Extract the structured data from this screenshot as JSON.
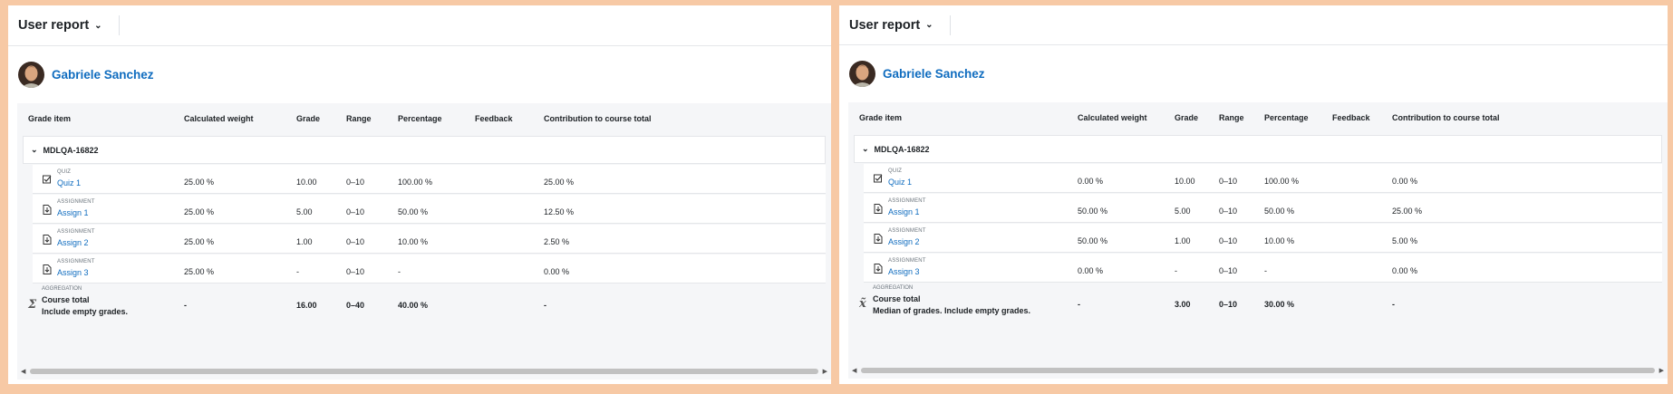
{
  "panels": [
    {
      "report_label": "User report",
      "user_name": "Gabriele Sanchez",
      "headers": [
        "Grade item",
        "Calculated weight",
        "Grade",
        "Range",
        "Percentage",
        "Feedback",
        "Contribution to course total"
      ],
      "category": "MDLQA-16822",
      "items": [
        {
          "type": "QUIZ",
          "name": "Quiz 1",
          "icon": "quiz-icon",
          "weight": "25.00 %",
          "grade": "10.00",
          "range": "0–10",
          "percentage": "100.00 %",
          "feedback": "",
          "contribution": "25.00 %"
        },
        {
          "type": "ASSIGNMENT",
          "name": "Assign 1",
          "icon": "assignment-icon",
          "weight": "25.00 %",
          "grade": "5.00",
          "range": "0–10",
          "percentage": "50.00 %",
          "feedback": "",
          "contribution": "12.50 %"
        },
        {
          "type": "ASSIGNMENT",
          "name": "Assign 2",
          "icon": "assignment-icon",
          "weight": "25.00 %",
          "grade": "1.00",
          "range": "0–10",
          "percentage": "10.00 %",
          "feedback": "",
          "contribution": "2.50 %"
        },
        {
          "type": "ASSIGNMENT",
          "name": "Assign 3",
          "icon": "assignment-icon",
          "weight": "25.00 %",
          "grade": "-",
          "range": "0–10",
          "percentage": "-",
          "feedback": "",
          "contribution": "0.00 %"
        }
      ],
      "total": {
        "type": "AGGREGATION",
        "name": "Course total",
        "desc": "Include empty grades.",
        "icon": "sum-icon",
        "weight": "-",
        "grade": "16.00",
        "range": "0–40",
        "percentage": "40.00 %",
        "contribution": "-"
      }
    },
    {
      "report_label": "User report",
      "user_name": "Gabriele Sanchez",
      "headers": [
        "Grade item",
        "Calculated weight",
        "Grade",
        "Range",
        "Percentage",
        "Feedback",
        "Contribution to course total"
      ],
      "category": "MDLQA-16822",
      "items": [
        {
          "type": "QUIZ",
          "name": "Quiz 1",
          "icon": "quiz-icon",
          "weight": "0.00 %",
          "grade": "10.00",
          "range": "0–10",
          "percentage": "100.00 %",
          "feedback": "",
          "contribution": "0.00 %"
        },
        {
          "type": "ASSIGNMENT",
          "name": "Assign 1",
          "icon": "assignment-icon",
          "weight": "50.00 %",
          "grade": "5.00",
          "range": "0–10",
          "percentage": "50.00 %",
          "feedback": "",
          "contribution": "25.00 %"
        },
        {
          "type": "ASSIGNMENT",
          "name": "Assign 2",
          "icon": "assignment-icon",
          "weight": "50.00 %",
          "grade": "1.00",
          "range": "0–10",
          "percentage": "10.00 %",
          "feedback": "",
          "contribution": "5.00 %"
        },
        {
          "type": "ASSIGNMENT",
          "name": "Assign 3",
          "icon": "assignment-icon",
          "weight": "0.00 %",
          "grade": "-",
          "range": "0–10",
          "percentage": "-",
          "feedback": "",
          "contribution": "0.00 %"
        }
      ],
      "total": {
        "type": "AGGREGATION",
        "name": "Course total",
        "desc": "Median of grades. Include empty grades.",
        "icon": "median-icon",
        "weight": "-",
        "grade": "3.00",
        "range": "0–10",
        "percentage": "30.00 %",
        "contribution": "-"
      }
    }
  ],
  "colors": {
    "link": "#0f6cbf",
    "page_background": "#f7c9a5",
    "table_background": "#f5f6f8"
  }
}
